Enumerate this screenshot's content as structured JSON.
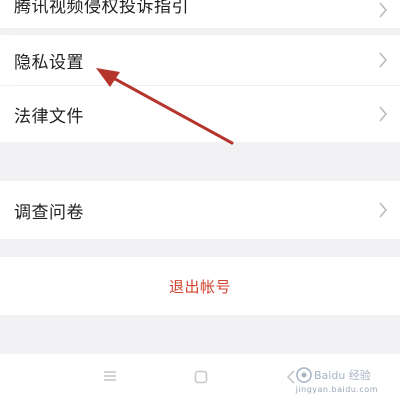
{
  "settings": {
    "items": [
      {
        "label": "腾讯视频侵权投诉指引"
      },
      {
        "label": "隐私设置"
      },
      {
        "label": "法律文件"
      },
      {
        "label": "调查问卷"
      }
    ],
    "logout_label": "退出帐号"
  },
  "annotation": {
    "arrow_color": "#b5352c",
    "target": "隐私设置"
  },
  "colors": {
    "logout": "#d2432f",
    "background": "#f2f2f4",
    "chevron": "#b9b9b9"
  },
  "watermark": {
    "text": "jingyan.baidu.com",
    "logo": "Baidu 经验"
  },
  "navbar": {
    "icons": [
      "menu-icon",
      "home-square-icon",
      "back-icon"
    ]
  }
}
